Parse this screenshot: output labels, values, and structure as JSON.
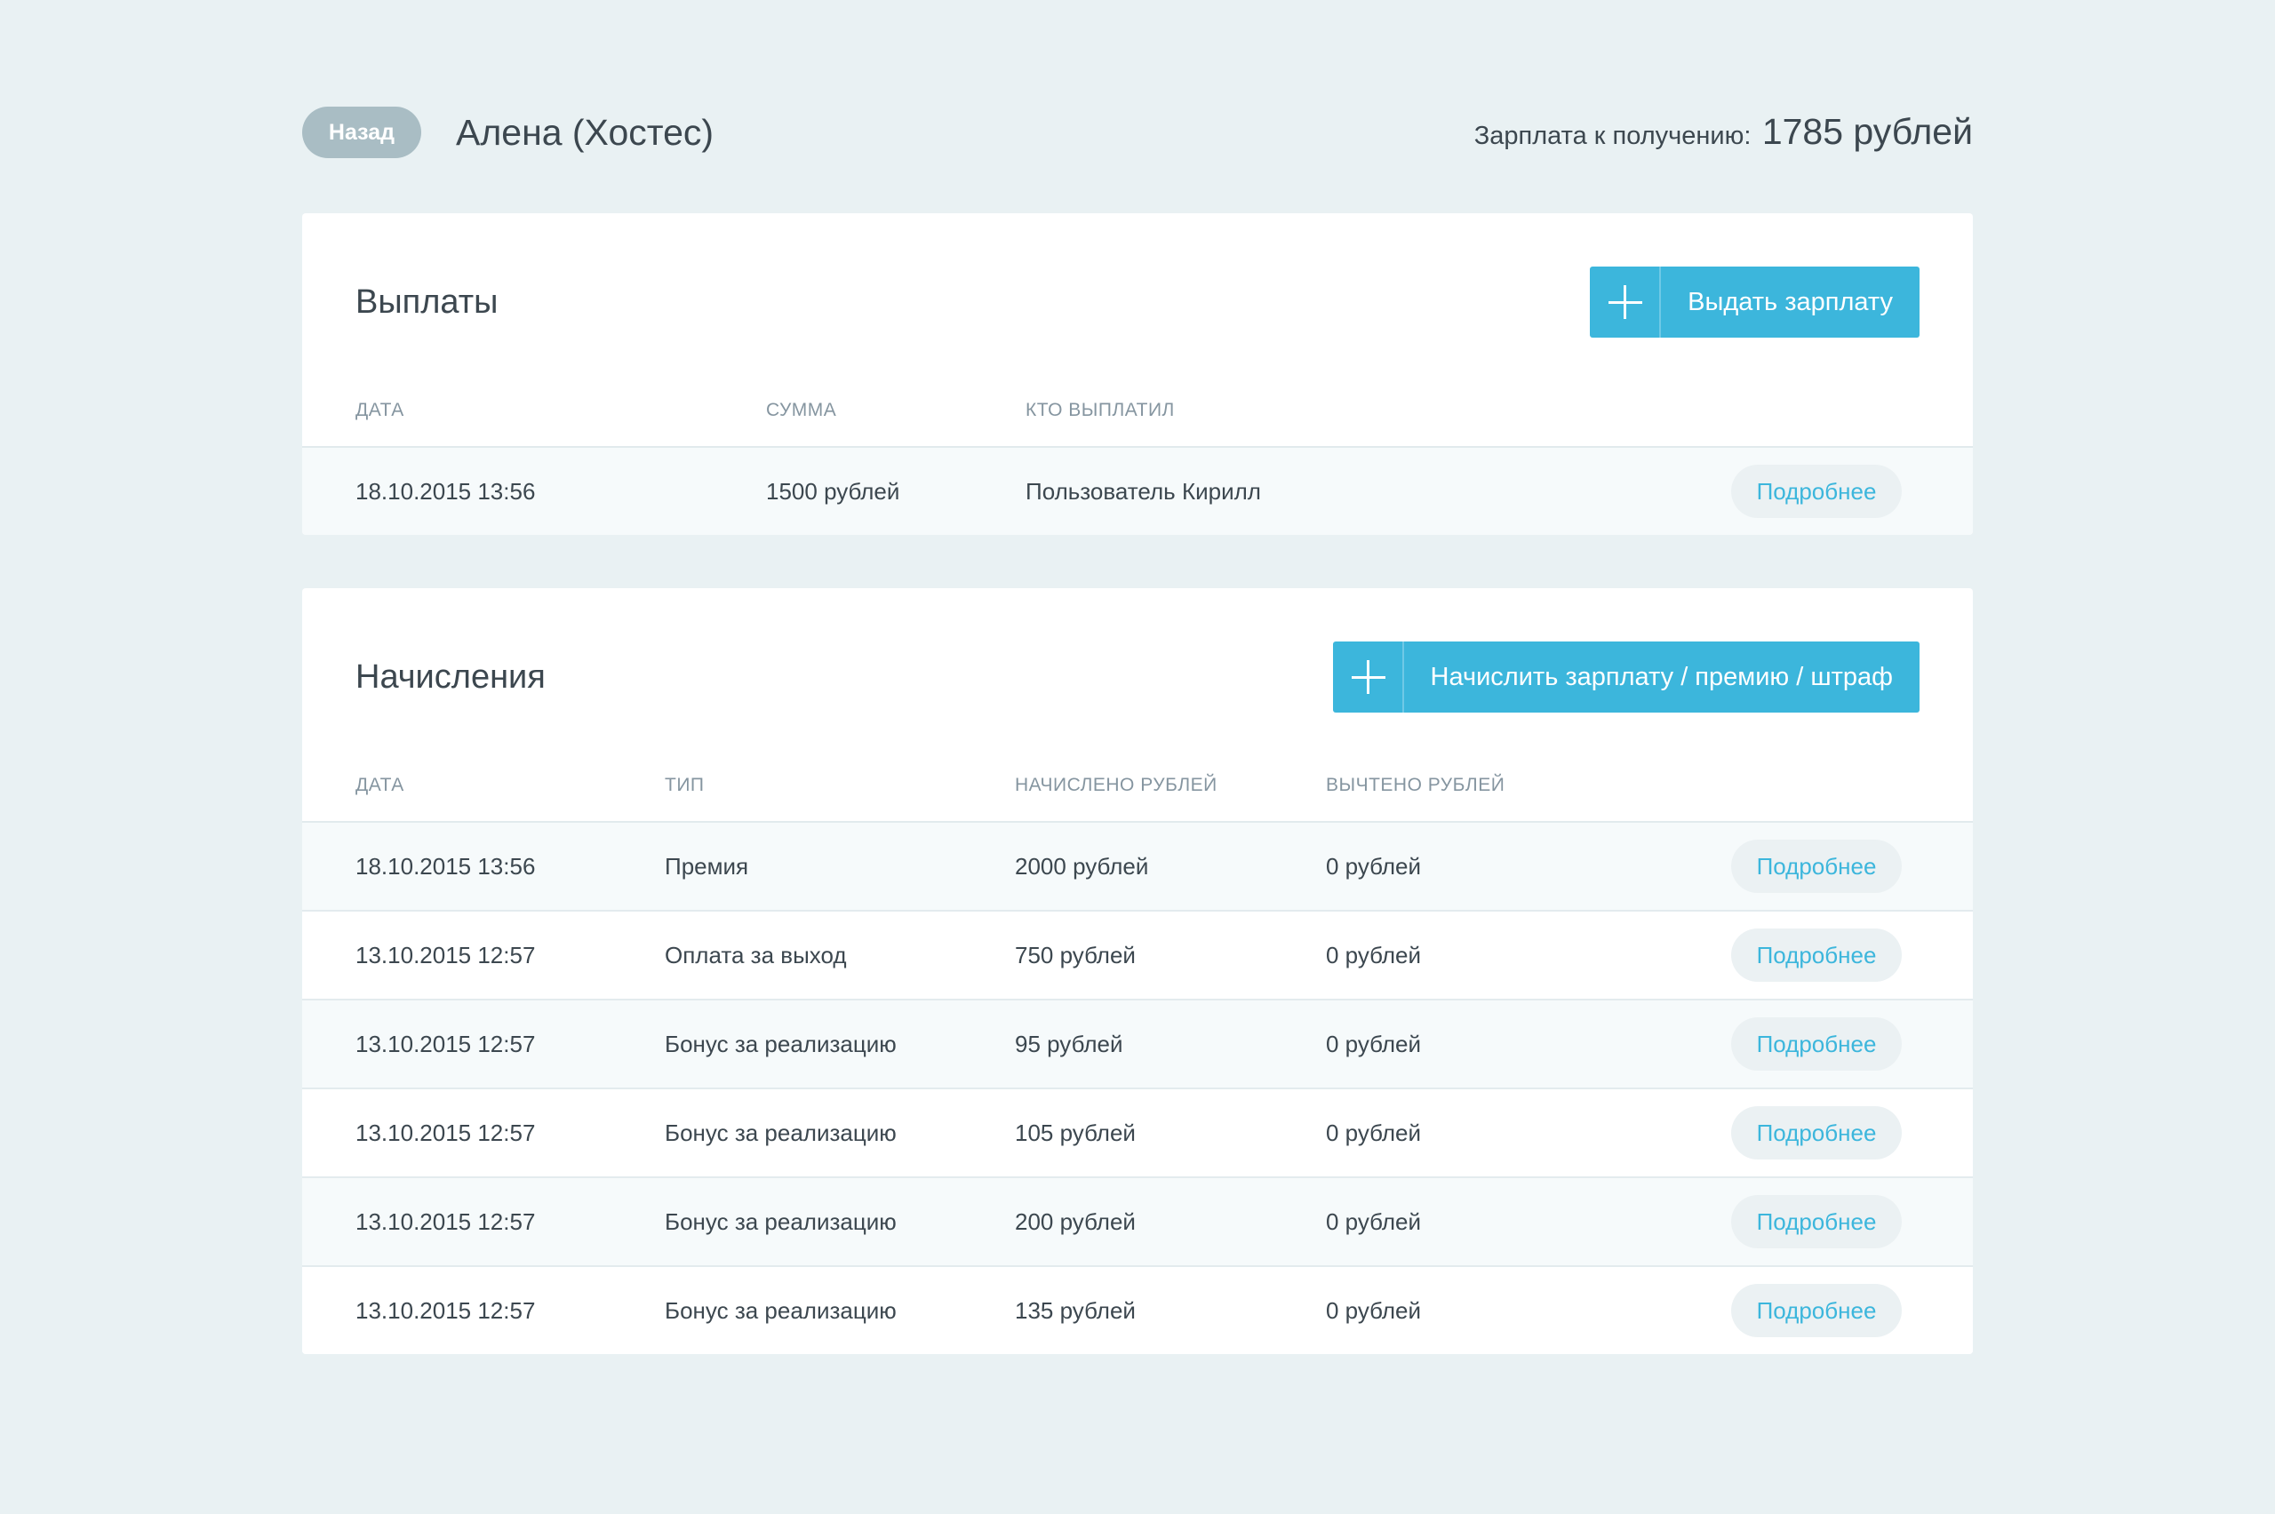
{
  "header": {
    "back_label": "Назад",
    "employee_name": "Алена (Хостес)",
    "salary_label": "Зарплата к получению:",
    "salary_amount": "1785 рублей"
  },
  "payouts": {
    "title": "Выплаты",
    "action_label": "Выдать зарплату",
    "columns": [
      "Дата",
      "Сумма",
      "Кто выплатил"
    ],
    "rows": [
      {
        "date": "18.10.2015 13:56",
        "amount": "1500 рублей",
        "payer": "Пользователь Кирилл",
        "more": "Подробнее"
      }
    ]
  },
  "accruals": {
    "title": "Начисления",
    "action_label": "Начислить зарплату / премию / штраф",
    "columns": [
      "Дата",
      "Тип",
      "Начислено рублей",
      "Вычтено рублей"
    ],
    "rows": [
      {
        "date": "18.10.2015 13:56",
        "type": "Премия",
        "accrued": "2000 рублей",
        "deducted": "0 рублей",
        "more": "Подробнее"
      },
      {
        "date": "13.10.2015 12:57",
        "type": "Оплата за выход",
        "accrued": "750 рублей",
        "deducted": "0 рублей",
        "more": "Подробнее"
      },
      {
        "date": "13.10.2015 12:57",
        "type": "Бонус за реализацию",
        "accrued": "95 рублей",
        "deducted": "0 рублей",
        "more": "Подробнее"
      },
      {
        "date": "13.10.2015 12:57",
        "type": "Бонус за реализацию",
        "accrued": "105 рублей",
        "deducted": "0 рублей",
        "more": "Подробнее"
      },
      {
        "date": "13.10.2015 12:57",
        "type": "Бонус за реализацию",
        "accrued": "200 рублей",
        "deducted": "0 рублей",
        "more": "Подробнее"
      },
      {
        "date": "13.10.2015 12:57",
        "type": "Бонус за реализацию",
        "accrued": "135 рублей",
        "deducted": "0 рублей",
        "more": "Подробнее"
      }
    ]
  },
  "icons": {
    "add": "plus-icon"
  },
  "colors": {
    "background": "#e9f1f3",
    "accent": "#3cb6dc",
    "back_button": "#a9bdc4",
    "row_alt": "#f6fafb"
  }
}
